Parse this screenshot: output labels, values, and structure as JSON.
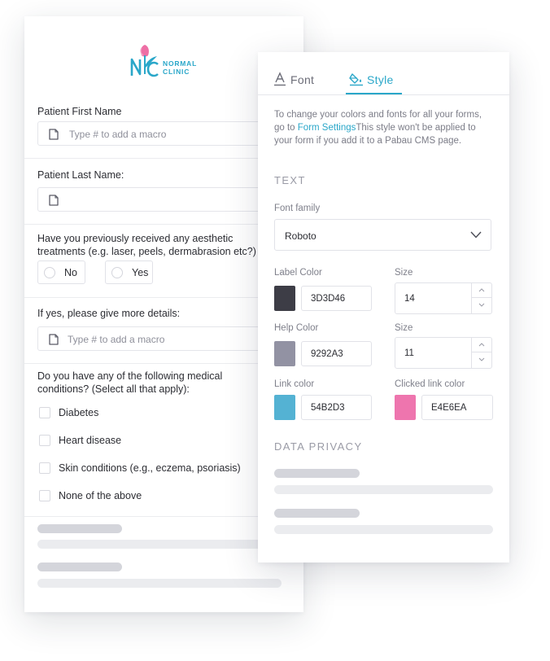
{
  "colors": {
    "accent": "#2aa7c9",
    "label_color": "#3D3D46",
    "help_color": "#9292A3",
    "link_color": "#54B2D3",
    "clicked_link_color": "#E4E6EA",
    "clicked_link_swatch": "#EE75AE"
  },
  "form": {
    "logo": {
      "line1": "NORMAL",
      "line2": "CLINIC"
    },
    "first_name": {
      "label": "Patient First Name",
      "placeholder": "Type # to add a macro"
    },
    "last_name": {
      "label": "Patient Last Name:",
      "placeholder": ""
    },
    "treatments": {
      "label_line1": "Have you previously received any aesthetic",
      "label_line2": "treatments (e.g. laser, peels, dermabrasion etc?)",
      "options": [
        "No",
        "Yes"
      ]
    },
    "details": {
      "label": "If yes, please give more details:",
      "placeholder": "Type # to add a macro"
    },
    "conditions": {
      "label_line1": "Do you have any of the following medical",
      "label_line2": "conditions? (Select all that apply):",
      "options": [
        "Diabetes",
        "Heart disease",
        "Skin conditions (e.g., eczema, psoriasis)",
        "None of the above"
      ]
    }
  },
  "panel": {
    "tabs": {
      "font": "Font",
      "style": "Style"
    },
    "info": {
      "before": "To change your colors and fonts for all your forms, go to ",
      "link": "Form Settings",
      "after": "This style won't be applied to your form if you add it to a Pabau CMS page."
    },
    "text_section": "TEXT",
    "font_family_label": "Font family",
    "font_family_value": "Roboto",
    "label_color_label": "Label Color",
    "label_color_value": "3D3D46",
    "label_size_label": "Size",
    "label_size_value": "14",
    "help_color_label": "Help Color",
    "help_color_value": "9292A3",
    "help_size_label": "Size",
    "help_size_value": "11",
    "link_color_label": "Link color",
    "link_color_value": "54B2D3",
    "clicked_link_label": "Clicked link color",
    "clicked_link_value": "E4E6EA",
    "privacy_section": "DATA PRIVACY"
  }
}
